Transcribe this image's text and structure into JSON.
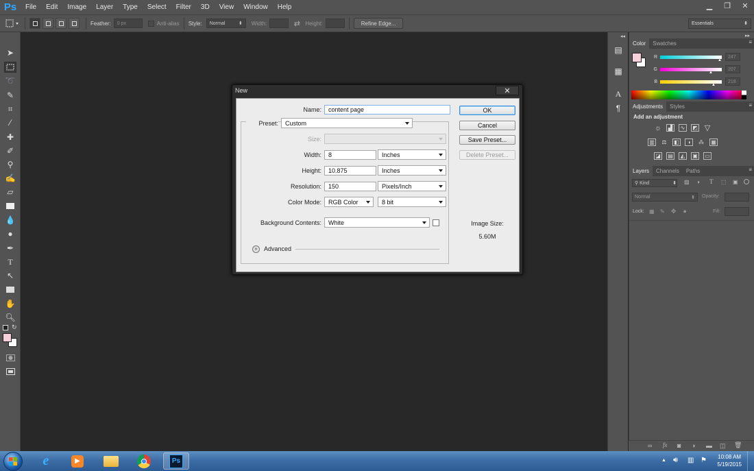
{
  "app": {
    "logo": "Ps"
  },
  "menu": [
    "File",
    "Edit",
    "Image",
    "Layer",
    "Type",
    "Select",
    "Filter",
    "3D",
    "View",
    "Window",
    "Help"
  ],
  "window_controls": {
    "minimize": "▁",
    "restore": "❐",
    "close": "✕"
  },
  "options_bar": {
    "feather_label": "Feather:",
    "feather_value": "0 px",
    "antialias_label": "Anti-alias",
    "style_label": "Style:",
    "style_value": "Normal",
    "width_label": "Width:",
    "height_label": "Height:",
    "refine_edge": "Refine Edge...",
    "workspace": "Essentials"
  },
  "colors": {
    "foreground": "#f7cfda",
    "background": "#ffffff",
    "r_value": "247",
    "g_value": "207",
    "b_value": "218"
  },
  "color_panel": {
    "tabs": [
      "Color",
      "Swatches"
    ],
    "channels": [
      "R",
      "G",
      "B"
    ],
    "channel_levels": [
      0.97,
      0.81,
      0.85
    ]
  },
  "adjustments_panel": {
    "tabs": [
      "Adjustments",
      "Styles"
    ],
    "heading": "Add an adjustment"
  },
  "layers_panel": {
    "tabs": [
      "Layers",
      "Channels",
      "Paths"
    ],
    "kind": "Kind",
    "blend_mode": "Normal",
    "opacity_label": "Opacity:",
    "lock_label": "Lock:",
    "fill_label": "Fill:"
  },
  "dialog": {
    "title": "New",
    "close": "✕",
    "name_label": "Name:",
    "name_value": "content page",
    "preset_label": "Preset:",
    "preset_value": "Custom",
    "size_label": "Size:",
    "width_label": "Width:",
    "width_value": "8",
    "width_unit": "Inches",
    "height_label": "Height:",
    "height_value": "10.875",
    "height_unit": "Inches",
    "resolution_label": "Resolution:",
    "resolution_value": "150",
    "resolution_unit": "Pixels/Inch",
    "color_mode_label": "Color Mode:",
    "color_mode_value": "RGB Color",
    "bit_depth": "8 bit",
    "background_label": "Background Contents:",
    "background_value": "White",
    "advanced_label": "Advanced",
    "ok": "OK",
    "cancel": "Cancel",
    "save_preset": "Save Preset...",
    "delete_preset": "Delete Preset...",
    "image_size_label": "Image Size:",
    "image_size_value": "5.60M"
  },
  "taskbar": {
    "time": "10:08 AM",
    "date": "5/19/2015"
  }
}
